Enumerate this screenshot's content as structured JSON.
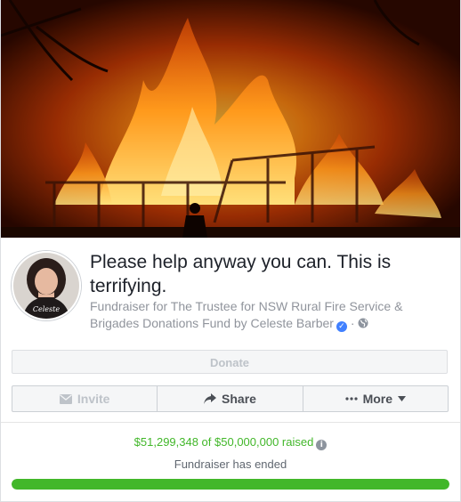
{
  "fundraiser": {
    "title": "Please help anyway you can. This is terrifying.",
    "subtitle": "Fundraiser for The Trustee for NSW Rural Fire Service & Brigades Donations Fund by Celeste Barber",
    "avatar_caption": "Celeste"
  },
  "buttons": {
    "donate": "Donate",
    "invite": "Invite",
    "share": "Share",
    "more": "More"
  },
  "progress": {
    "raised_text": "$51,299,348 of $50,000,000 raised",
    "status_text": "Fundraiser has ended",
    "fraction": 1.0
  },
  "colors": {
    "accent_green": "#42b72a",
    "verified_blue": "#4080ff"
  },
  "icons": [
    "verified-badge-icon",
    "globe-icon",
    "envelope-icon",
    "share-arrow-icon",
    "more-dots-icon",
    "caret-down-icon",
    "info-icon"
  ]
}
